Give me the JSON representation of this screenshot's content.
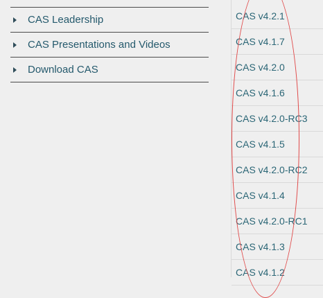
{
  "nav": {
    "items": [
      {
        "label": "CAS Leadership"
      },
      {
        "label": "CAS Presentations and Videos"
      },
      {
        "label": "Download CAS"
      }
    ]
  },
  "versions": [
    "CAS v4.2.1",
    "CAS v4.1.7",
    "CAS v4.2.0",
    "CAS v4.1.6",
    "CAS v4.2.0-RC3",
    "CAS v4.1.5",
    "CAS v4.2.0-RC2",
    "CAS v4.1.4",
    "CAS v4.2.0-RC1",
    "CAS v4.1.3",
    "CAS v4.1.2"
  ],
  "colors": {
    "link": "#2b6676",
    "nav_link": "#24596c",
    "annotation": "#e04848",
    "background": "#efefef"
  }
}
